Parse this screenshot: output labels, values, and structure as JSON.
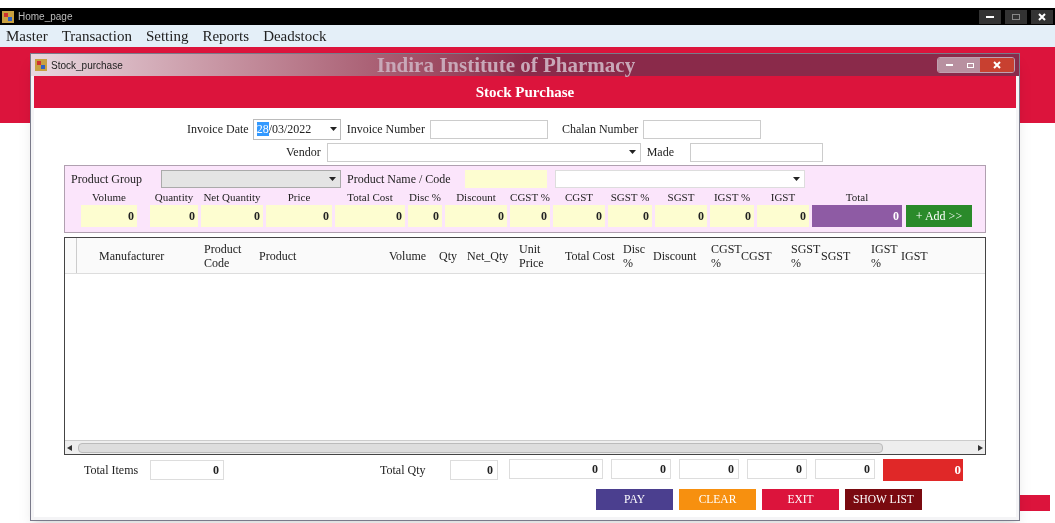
{
  "app_title": "Home_page",
  "menu": [
    "Master",
    "Transaction",
    "Setting",
    "Reports",
    "Deadstock"
  ],
  "background_title": "Indira Institute of Pharmacy",
  "window": {
    "title": "Stock_purchase"
  },
  "header": "Stock Purchase",
  "invoice_date": {
    "label": "Invoice Date",
    "value_parts": [
      {
        "text": "28",
        "selected": true
      },
      {
        "text": "/03/2022",
        "selected": false
      }
    ]
  },
  "invoice_number": {
    "label": "Invoice Number"
  },
  "chalan_number": {
    "label": "Chalan Number"
  },
  "vendor": {
    "label": "Vendor"
  },
  "made": {
    "label": "Made"
  },
  "product_group": {
    "label": "Product Group"
  },
  "product_name": {
    "label": "Product Name / Code"
  },
  "product_fields": [
    {
      "label": "Volume",
      "value": "0",
      "kind": "input"
    },
    {
      "label": "Quantity",
      "value": "0",
      "kind": "input"
    },
    {
      "label": "Net Quantity",
      "value": "0",
      "kind": "input"
    },
    {
      "label": "Price",
      "value": "0",
      "kind": "input"
    },
    {
      "label": "Total Cost",
      "value": "0",
      "kind": "input"
    },
    {
      "label": "Disc %",
      "value": "0",
      "kind": "input"
    },
    {
      "label": "Discount",
      "value": "0",
      "kind": "input"
    },
    {
      "label": "CGST %",
      "value": "0",
      "kind": "input"
    },
    {
      "label": "CGST",
      "value": "0",
      "kind": "input"
    },
    {
      "label": "SGST %",
      "value": "0",
      "kind": "input"
    },
    {
      "label": "SGST",
      "value": "0",
      "kind": "input"
    },
    {
      "label": "IGST %",
      "value": "0",
      "kind": "input"
    },
    {
      "label": "IGST",
      "value": "0",
      "kind": "input"
    },
    {
      "label": "Total",
      "value": "0",
      "kind": "total"
    }
  ],
  "add_button": "+ Add >>",
  "table": {
    "columns": [
      "Manufacturer",
      "Product Code",
      "Product",
      "Volume",
      "Qty",
      "Net_Qty",
      "Unit Price",
      "Total Cost",
      "Disc %",
      "Discount",
      "CGST %",
      "CGST",
      "SGST %",
      "SGST",
      "IGST %",
      "IGST"
    ]
  },
  "totals": {
    "items_label": "Total Items",
    "items_value": "0",
    "qty_label": "Total Qty",
    "qty_value": "0",
    "fields": [
      {
        "value": "0",
        "kind": "plain"
      },
      {
        "value": "0",
        "kind": "plain"
      },
      {
        "value": "0",
        "kind": "plain"
      },
      {
        "value": "0",
        "kind": "plain"
      },
      {
        "value": "0",
        "kind": "plain"
      },
      {
        "value": "0",
        "kind": "grand"
      }
    ]
  },
  "buttons": [
    {
      "label": "PAY",
      "color": "#4b3f8f"
    },
    {
      "label": "CLEAR",
      "color": "#f7900f"
    },
    {
      "label": "EXIT",
      "color": "#dc143c"
    },
    {
      "label": "SHOW LIST",
      "color": "#7a0a10"
    }
  ]
}
